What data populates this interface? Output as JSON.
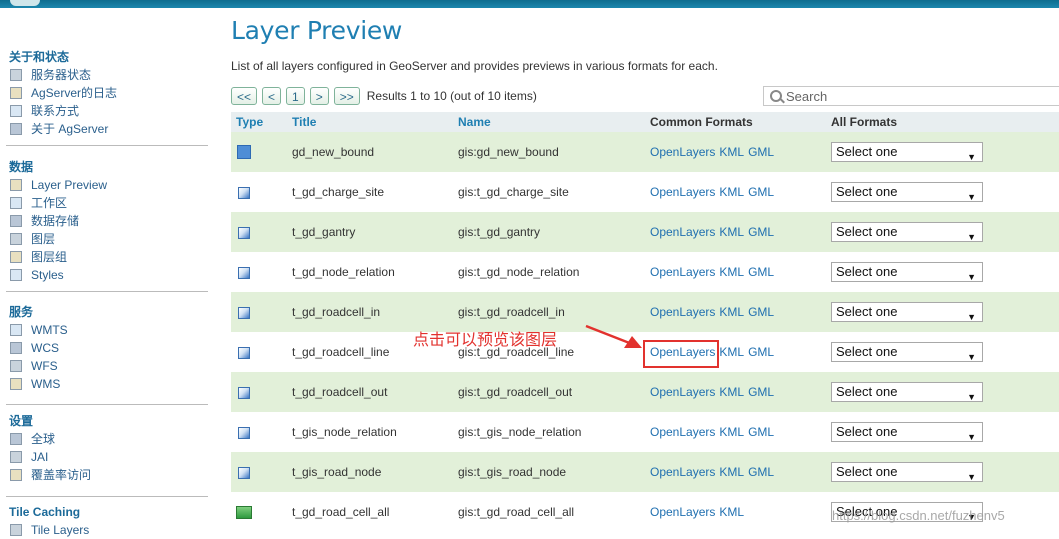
{
  "sidebar": {
    "sections": [
      {
        "title": "关于和状态",
        "items": [
          {
            "label": "服务器状态",
            "icon": "server-status-icon"
          },
          {
            "label": "AgServer的日志",
            "icon": "log-icon"
          },
          {
            "label": "联系方式",
            "icon": "contact-icon"
          },
          {
            "label": "关于 AgServer",
            "icon": "about-icon"
          }
        ]
      },
      {
        "title": "数据",
        "items": [
          {
            "label": "Layer Preview",
            "icon": "layer-preview-icon"
          },
          {
            "label": "工作区",
            "icon": "folder-icon"
          },
          {
            "label": "数据存储",
            "icon": "database-icon"
          },
          {
            "label": "图层",
            "icon": "layer-icon"
          },
          {
            "label": "图层组",
            "icon": "layer-group-icon"
          },
          {
            "label": "Styles",
            "icon": "styles-icon"
          }
        ]
      },
      {
        "title": "服务",
        "items": [
          {
            "label": "WMTS",
            "icon": "wmts-icon"
          },
          {
            "label": "WCS",
            "icon": "wcs-icon"
          },
          {
            "label": "WFS",
            "icon": "wfs-icon"
          },
          {
            "label": "WMS",
            "icon": "wms-icon"
          }
        ]
      },
      {
        "title": "设置",
        "items": [
          {
            "label": "全球",
            "icon": "global-icon"
          },
          {
            "label": "JAI",
            "icon": "jai-icon"
          },
          {
            "label": "覆盖率访问",
            "icon": "coverage-icon"
          }
        ]
      },
      {
        "title": "Tile Caching",
        "items": [
          {
            "label": "Tile Layers",
            "icon": "tile-layers-icon"
          }
        ]
      }
    ]
  },
  "main": {
    "title": "Layer Preview",
    "description": "List of all layers configured in GeoServer and provides previews in various formats for each.",
    "pager": {
      "first": "<<",
      "prev": "<",
      "page": "1",
      "next": ">",
      "last": ">>",
      "info": "Results 1 to 10 (out of 10 items)"
    },
    "search_placeholder": "Search",
    "columns": {
      "type": "Type",
      "title": "Title",
      "name": "Name",
      "common": "Common Formats",
      "all": "All Formats"
    },
    "rows": [
      {
        "type": "polygon",
        "title": "gd_new_bound",
        "name": "gis:gd_new_bound",
        "formats": [
          "OpenLayers",
          "KML",
          "GML"
        ],
        "select": "Select one"
      },
      {
        "type": "line",
        "title": "t_gd_charge_site",
        "name": "gis:t_gd_charge_site",
        "formats": [
          "OpenLayers",
          "KML",
          "GML"
        ],
        "select": "Select one"
      },
      {
        "type": "line",
        "title": "t_gd_gantry",
        "name": "gis:t_gd_gantry",
        "formats": [
          "OpenLayers",
          "KML",
          "GML"
        ],
        "select": "Select one"
      },
      {
        "type": "line",
        "title": "t_gd_node_relation",
        "name": "gis:t_gd_node_relation",
        "formats": [
          "OpenLayers",
          "KML",
          "GML"
        ],
        "select": "Select one"
      },
      {
        "type": "line",
        "title": "t_gd_roadcell_in",
        "name": "gis:t_gd_roadcell_in",
        "formats": [
          "OpenLayers",
          "KML",
          "GML"
        ],
        "select": "Select one"
      },
      {
        "type": "line",
        "title": "t_gd_roadcell_line",
        "name": "gis:t_gd_roadcell_line",
        "formats": [
          "OpenLayers",
          "KML",
          "GML"
        ],
        "select": "Select one"
      },
      {
        "type": "line",
        "title": "t_gd_roadcell_out",
        "name": "gis:t_gd_roadcell_out",
        "formats": [
          "OpenLayers",
          "KML",
          "GML"
        ],
        "select": "Select one"
      },
      {
        "type": "line",
        "title": "t_gis_node_relation",
        "name": "gis:t_gis_node_relation",
        "formats": [
          "OpenLayers",
          "KML",
          "GML"
        ],
        "select": "Select one"
      },
      {
        "type": "line",
        "title": "t_gis_road_node",
        "name": "gis:t_gis_road_node",
        "formats": [
          "OpenLayers",
          "KML",
          "GML"
        ],
        "select": "Select one"
      },
      {
        "type": "raster",
        "title": "t_gd_road_cell_all",
        "name": "gis:t_gd_road_cell_all",
        "formats": [
          "OpenLayers",
          "KML"
        ],
        "select": "Select one"
      }
    ]
  },
  "annotation": {
    "text": "点击可以预览该图层",
    "color": "#e2322e"
  },
  "watermark": "https://blog.csdn.net/fuzhenv5"
}
